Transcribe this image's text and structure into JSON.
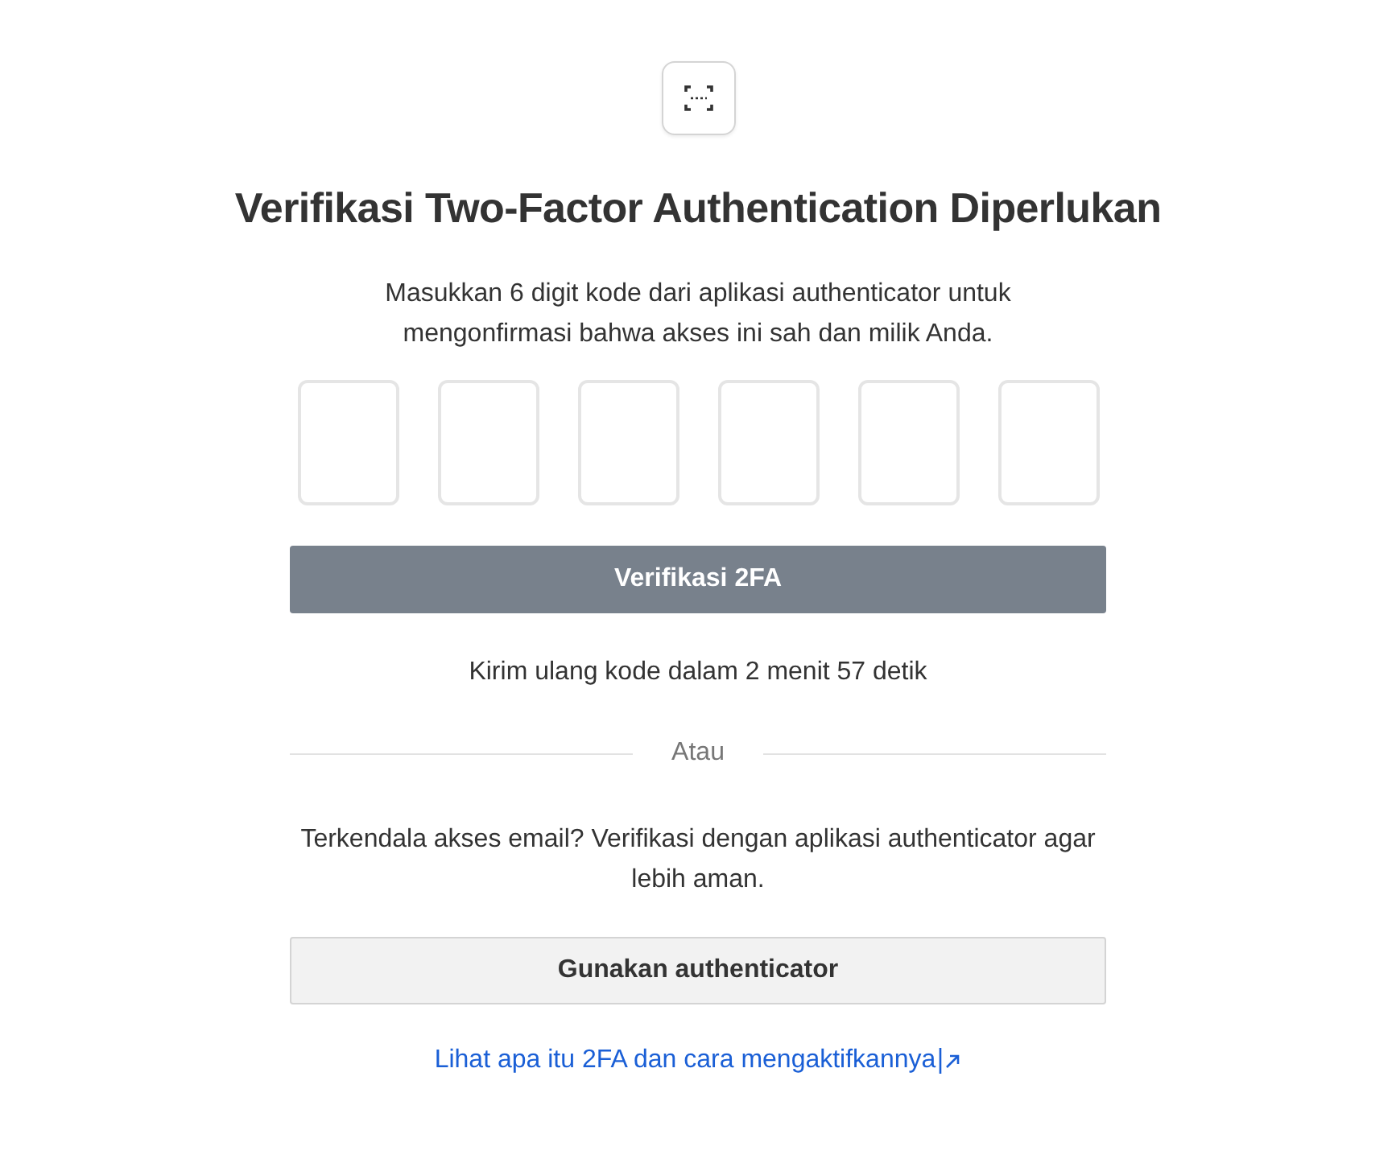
{
  "title": "Verifikasi Two-Factor Authentication Diperlukan",
  "description": "Masukkan 6 digit kode dari aplikasi authenticator untuk mengonfirmasi bahwa akses ini sah dan milik Anda.",
  "code_digits": [
    {
      "filled": false
    },
    {
      "filled": false
    },
    {
      "filled": false
    },
    {
      "filled": false
    },
    {
      "filled": false
    },
    {
      "filled": false
    }
  ],
  "verify_button": {
    "label": "Verifikasi 2FA",
    "disabled": true
  },
  "resend_text": "Kirim ulang kode dalam 2 menit 57 detik",
  "divider_label": "Atau",
  "alt_text": "Terkendala akses email? Verifikasi dengan aplikasi authenticator agar lebih aman.",
  "alt_button": {
    "label": "Gunakan authenticator"
  },
  "help_link": "Lihat apa itu 2FA dan cara mengaktifkannya"
}
